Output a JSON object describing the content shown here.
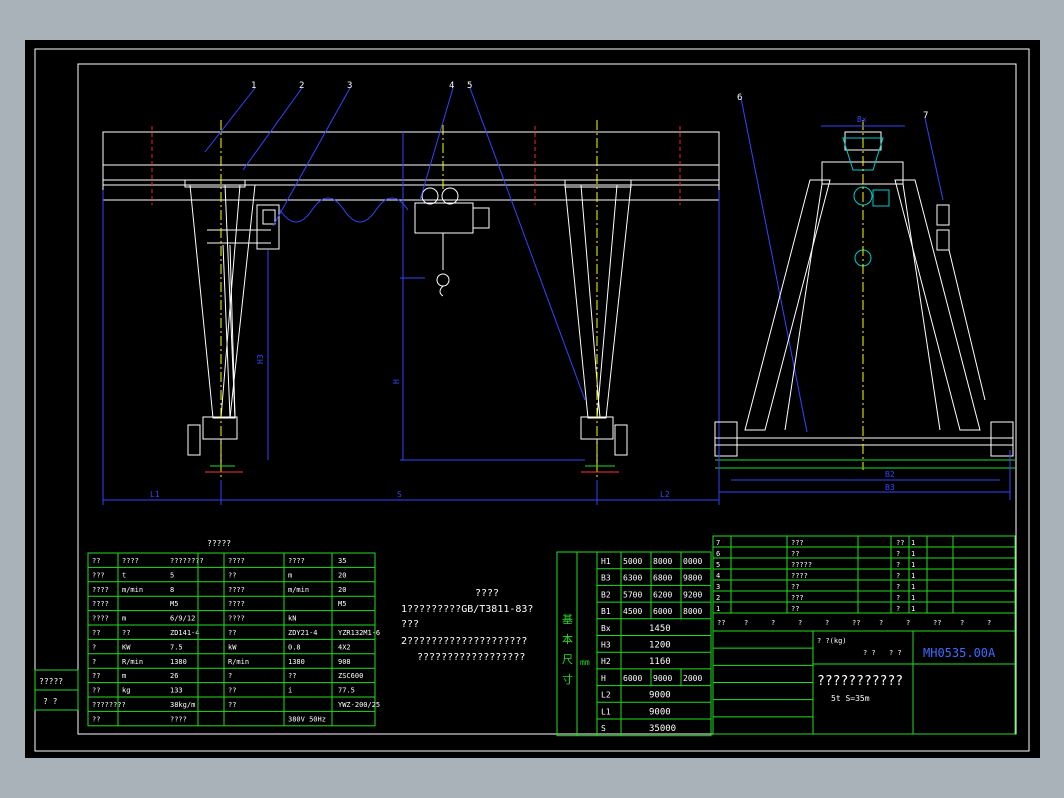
{
  "balloons": [
    "1",
    "2",
    "3",
    "4",
    "5",
    "6",
    "7"
  ],
  "dims": {
    "front_left": "L1",
    "front_span": "S",
    "front_right": "L2",
    "front_h3": "H3",
    "front_h": "H",
    "side_b2": "B2",
    "side_b3": "B3",
    "side_bx": "Bx"
  },
  "params_title": "?????",
  "params_rows": [
    [
      "??",
      "????",
      "????????",
      "????",
      "????",
      "35"
    ],
    [
      "???",
      "t",
      "5",
      "??",
      "m",
      "20"
    ],
    [
      "????",
      "m/min",
      "8",
      "????",
      "m/min",
      "20"
    ],
    [
      "????",
      "",
      "M5",
      "????",
      "",
      "M5"
    ],
    [
      "????",
      "m",
      "6/9/12",
      "????",
      "kN",
      ""
    ],
    [
      "??",
      "??",
      "ZD141-4",
      "??",
      "ZDY21-4",
      "YZR132M1-6"
    ],
    [
      "?",
      "KW",
      "7.5",
      "kW",
      "0.8",
      "4X2"
    ],
    [
      "?",
      "R/min",
      "1380",
      "R/min",
      "1380",
      "908"
    ],
    [
      "??",
      "m",
      "26",
      "?",
      "??",
      "ZSC600"
    ],
    [
      "??",
      "kg",
      "133",
      "??",
      "i",
      "77.5"
    ],
    [
      "????????",
      "",
      "38kg/m",
      "??",
      "",
      "YWZ-200/25"
    ],
    [
      "??",
      "",
      "????",
      "",
      "380V  50Hz",
      ""
    ]
  ],
  "notes": {
    "title": "????",
    "line1": "1?????????GB/T3811-83?",
    "line2": "???",
    "line3": "2????????????????????",
    "line4": "??????????????????"
  },
  "dim_table": {
    "side_label": "基 本 尺 寸",
    "unit": "mm",
    "rows": [
      {
        "k": "H1",
        "v": [
          "5000",
          "8000",
          "0000"
        ]
      },
      {
        "k": "B3",
        "v": [
          "6300",
          "6800",
          "9800"
        ]
      },
      {
        "k": "B2",
        "v": [
          "5700",
          "6200",
          "9200"
        ]
      },
      {
        "k": "B1",
        "v": [
          "4500",
          "6000",
          "8000"
        ]
      },
      {
        "k": "Bx",
        "v": [
          "1450"
        ]
      },
      {
        "k": "H3",
        "v": [
          "1200"
        ]
      },
      {
        "k": "H2",
        "v": [
          "1160"
        ]
      },
      {
        "k": "H",
        "v": [
          "6000",
          "9000",
          "2000"
        ]
      },
      {
        "k": "L2",
        "v": [
          "9000"
        ]
      },
      {
        "k": "L1",
        "v": [
          "9000"
        ]
      },
      {
        "k": "S",
        "v": [
          "35000"
        ]
      }
    ]
  },
  "left_stamp": [
    "?????",
    "?  ?"
  ],
  "title_block": {
    "drawing_no": "MH0535.00A",
    "name": "???????????",
    "spec": "5t  S=35m",
    "weight": "?  ?(kg)",
    "scale": "? ?",
    "sheet": "?  ?",
    "rev_rows": [
      [
        "7",
        "???",
        "",
        "",
        "??",
        "1"
      ],
      [
        "6",
        "??",
        "",
        "",
        "?",
        "1"
      ],
      [
        "5",
        "?????",
        "",
        "",
        "?",
        "1"
      ],
      [
        "4",
        "????",
        "",
        "",
        "?",
        "1"
      ],
      [
        "3",
        "??",
        "",
        "",
        "?",
        "1"
      ],
      [
        "2",
        "???",
        "",
        "",
        "?",
        "1"
      ],
      [
        "1",
        "??",
        "",
        "",
        "?",
        "1"
      ]
    ],
    "header_row": [
      "??",
      "?",
      "?",
      "?",
      "?",
      "??",
      "?",
      "?",
      "??",
      "?",
      "?"
    ]
  },
  "colors": {
    "background": "#000000",
    "frame": "#ffffff",
    "structure": "#ffffff",
    "dimension": "#3344ff",
    "table": "#22dd22",
    "text": "#ffffff",
    "centerline": "#ffff00",
    "cutline": "#ff2222",
    "crane": "#00cccc"
  }
}
